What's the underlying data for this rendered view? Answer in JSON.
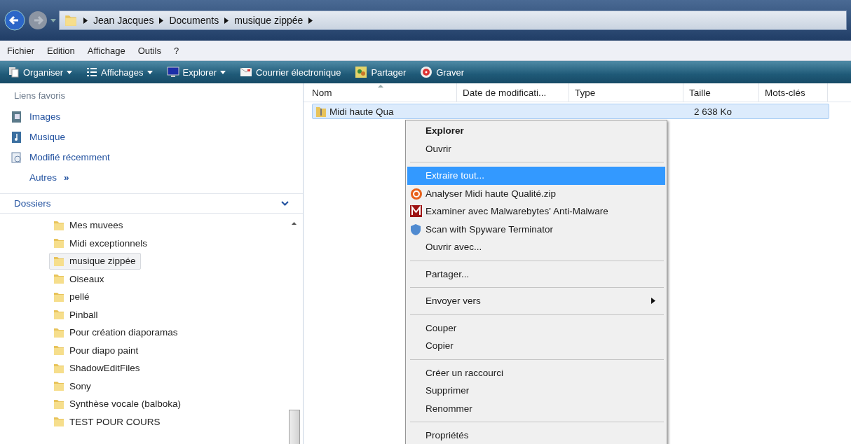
{
  "address_bar": {
    "crumbs": [
      "Jean Jacques",
      "Documents",
      "musique zippée"
    ]
  },
  "menu_bar": [
    "Fichier",
    "Edition",
    "Affichage",
    "Outils",
    "?"
  ],
  "toolbar": [
    {
      "label": "Organiser",
      "has_dropdown": true
    },
    {
      "label": "Affichages",
      "has_dropdown": true
    },
    {
      "label": "Explorer",
      "has_dropdown": true
    },
    {
      "label": "Courrier électronique",
      "has_dropdown": false
    },
    {
      "label": "Partager",
      "has_dropdown": false
    },
    {
      "label": "Graver",
      "has_dropdown": false
    }
  ],
  "favorites": {
    "title": "Liens favoris",
    "items": [
      "Images",
      "Musique",
      "Modifié récemment"
    ],
    "more": "Autres",
    "more_glyph": "»"
  },
  "folders": {
    "title": "Dossiers",
    "items": [
      {
        "label": "Mes muvees",
        "selected": false
      },
      {
        "label": "Midi exceptionnels",
        "selected": false
      },
      {
        "label": "musique zippée",
        "selected": true
      },
      {
        "label": "Oiseaux",
        "selected": false
      },
      {
        "label": "pellé",
        "selected": false
      },
      {
        "label": "Pinball",
        "selected": false
      },
      {
        "label": "Pour création diaporamas",
        "selected": false
      },
      {
        "label": "Pour diapo paint",
        "selected": false
      },
      {
        "label": "ShadowEditFiles",
        "selected": false
      },
      {
        "label": "Sony",
        "selected": false
      },
      {
        "label": "Synthèse vocale (balboka)",
        "selected": false
      },
      {
        "label": "TEST POUR COURS",
        "selected": false
      }
    ]
  },
  "file_list": {
    "columns": [
      "Nom",
      "Date de modificati...",
      "Type",
      "Taille",
      "Mots-clés"
    ],
    "rows": [
      {
        "name": "Midi haute Qua",
        "size": "2 638 Ko",
        "selected": true
      }
    ]
  },
  "context_menu": [
    {
      "kind": "default",
      "label": "Explorer"
    },
    {
      "kind": "plain",
      "label": "Ouvrir"
    },
    {
      "kind": "separator"
    },
    {
      "kind": "plain",
      "label": "Extraire tout...",
      "selected": true
    },
    {
      "kind": "app",
      "label": "Analyser Midi haute Qualité.zip",
      "selected": false
    },
    {
      "kind": "app",
      "label": "Examiner avec Malwarebytes' Anti-Malware",
      "selected": false
    },
    {
      "kind": "app",
      "label": "Scan with Spyware Terminator",
      "selected": false
    },
    {
      "kind": "plain",
      "label": "Ouvrir avec...",
      "selected": false
    },
    {
      "kind": "separator"
    },
    {
      "kind": "plain",
      "label": "Partager...",
      "selected": false
    },
    {
      "kind": "separator"
    },
    {
      "kind": "submenu",
      "label": "Envoyer vers",
      "selected": false
    },
    {
      "kind": "separator"
    },
    {
      "kind": "plain",
      "label": "Couper",
      "selected": false
    },
    {
      "kind": "plain",
      "label": "Copier",
      "selected": false
    },
    {
      "kind": "separator"
    },
    {
      "kind": "plain",
      "label": "Créer un raccourci",
      "selected": false
    },
    {
      "kind": "plain",
      "label": "Supprimer",
      "selected": false
    },
    {
      "kind": "plain",
      "label": "Renommer",
      "selected": false
    },
    {
      "kind": "separator"
    },
    {
      "kind": "plain",
      "label": "Propriétés",
      "selected": false
    }
  ]
}
